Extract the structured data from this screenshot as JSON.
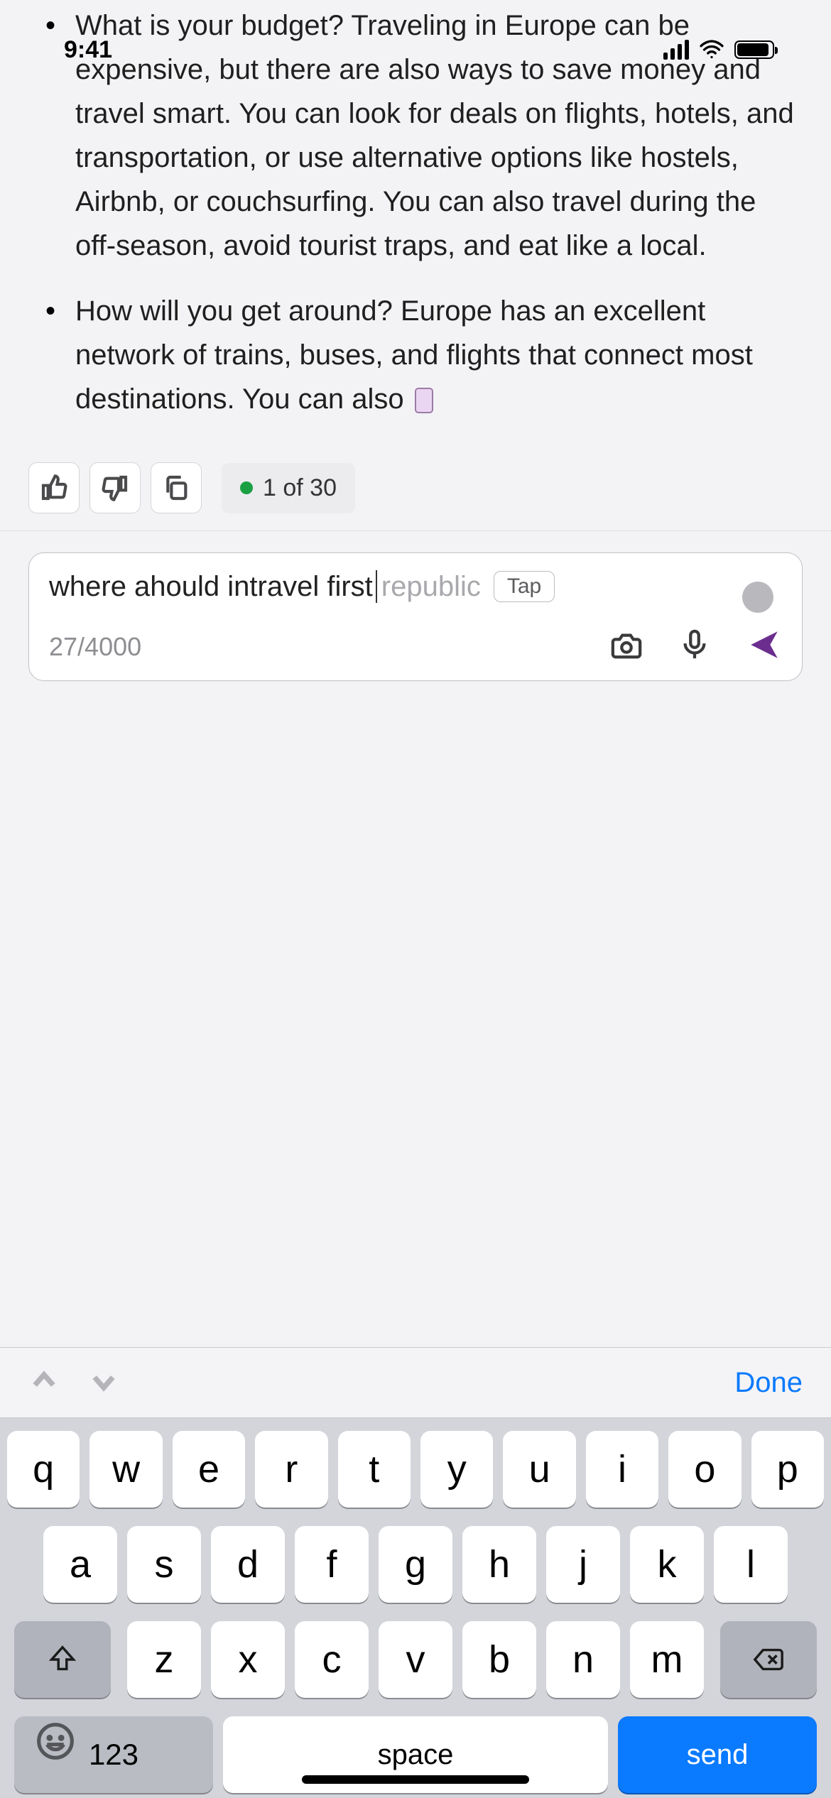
{
  "status_bar": {
    "time": "9:41"
  },
  "chat": {
    "bullets": [
      "What is your budget? Traveling in Europe can be expensive, but there are also ways to save money and travel smart. You can look for deals on flights, hotels, and transportation, or use alternative options like hostels, Airbnb, or couchsurfing. You can also travel during the off-season, avoid tourist traps, and eat like a local.",
      "How will you get around? Europe has an excellent network of trains, buses, and flights that connect most destinations. You can also"
    ]
  },
  "feedback": {
    "badge_text": "1 of 30"
  },
  "input": {
    "typed": "where ahould intravel first",
    "suggestion": " republic",
    "tap_label": "Tap",
    "counter": "27/4000"
  },
  "kb_accessory": {
    "done": "Done"
  },
  "keyboard": {
    "row1": [
      "q",
      "w",
      "e",
      "r",
      "t",
      "y",
      "u",
      "i",
      "o",
      "p"
    ],
    "row2": [
      "a",
      "s",
      "d",
      "f",
      "g",
      "h",
      "j",
      "k",
      "l"
    ],
    "row3": [
      "z",
      "x",
      "c",
      "v",
      "b",
      "n",
      "m"
    ],
    "numbers": "123",
    "space": "space",
    "send": "send"
  }
}
